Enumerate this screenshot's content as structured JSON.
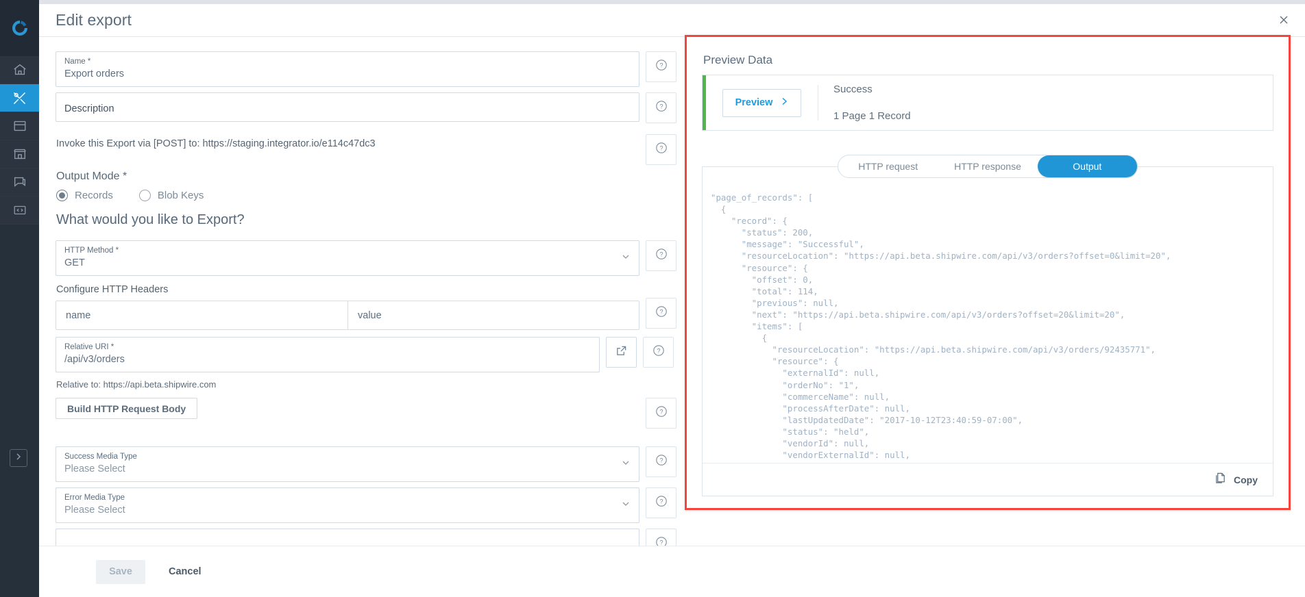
{
  "header": {
    "title": "Edit export",
    "close_icon": "close-icon"
  },
  "rail": {
    "logo_icon": "celigo-logo-icon",
    "items": [
      {
        "icon": "home-icon",
        "name": "home",
        "active": false
      },
      {
        "icon": "tools-icon",
        "name": "tools",
        "active": true
      },
      {
        "icon": "box-icon",
        "name": "connections",
        "active": false
      },
      {
        "icon": "marketplace-icon",
        "name": "marketplace",
        "active": false
      },
      {
        "icon": "chat-icon",
        "name": "support",
        "active": false
      },
      {
        "icon": "code-icon",
        "name": "developer",
        "active": false
      }
    ],
    "expand_icon": "chevron-right-icon"
  },
  "form": {
    "name_field": {
      "label": "Name *",
      "value": "Export orders"
    },
    "description_field": {
      "label": "",
      "value": "Description"
    },
    "invoke_text": "Invoke this Export via [POST] to: https://staging.integrator.io/e114c47dc3",
    "output_mode": {
      "label": "Output Mode *",
      "options": [
        {
          "label": "Records",
          "selected": true
        },
        {
          "label": "Blob Keys",
          "selected": false
        }
      ]
    },
    "export_question": "What would you like to Export?",
    "http_method": {
      "label": "HTTP Method *",
      "value": "GET"
    },
    "configure_headers_label": "Configure HTTP Headers",
    "headers_table": {
      "columns": [
        "name",
        "value"
      ],
      "rows": []
    },
    "relative_uri": {
      "label": "Relative URI *",
      "value": "/api/v3/orders"
    },
    "relative_to_text": "Relative to: https://api.beta.shipwire.com",
    "build_body_button": "Build HTTP Request Body",
    "success_media_type": {
      "label": "Success Media Type",
      "value": "Please Select"
    },
    "error_media_type": {
      "label": "Error Media Type",
      "value": "Please Select"
    },
    "help_icon": "question-mark-icon",
    "external_link_icon": "external-link-icon",
    "chevron_icon": "chevron-down-icon"
  },
  "footer": {
    "save_label": "Save",
    "cancel_label": "Cancel"
  },
  "preview": {
    "title": "Preview Data",
    "button_label": "Preview",
    "button_icon": "chevron-right-icon",
    "status": "Success",
    "record_count": "1 Page 1 Record",
    "accent_color": "#52b74a",
    "highlight_color": "#f4443b",
    "tabs": [
      {
        "label": "HTTP request",
        "active": false
      },
      {
        "label": "HTTP response",
        "active": false
      },
      {
        "label": "Output",
        "active": true
      }
    ],
    "copy_label": "Copy",
    "copy_icon": "copy-icon",
    "json_text": "\"page_of_records\": [\n  {\n    \"record\": {\n      \"status\": 200,\n      \"message\": \"Successful\",\n      \"resourceLocation\": \"https://api.beta.shipwire.com/api/v3/orders?offset=0&limit=20\",\n      \"resource\": {\n        \"offset\": 0,\n        \"total\": 114,\n        \"previous\": null,\n        \"next\": \"https://api.beta.shipwire.com/api/v3/orders?offset=20&limit=20\",\n        \"items\": [\n          {\n            \"resourceLocation\": \"https://api.beta.shipwire.com/api/v3/orders/92435771\",\n            \"resource\": {\n              \"externalId\": null,\n              \"orderNo\": \"1\",\n              \"commerceName\": null,\n              \"processAfterDate\": null,\n              \"lastUpdatedDate\": \"2017-10-12T23:40:59-07:00\",\n              \"status\": \"held\",\n              \"vendorId\": null,\n              \"vendorExternalId\": null,"
  }
}
